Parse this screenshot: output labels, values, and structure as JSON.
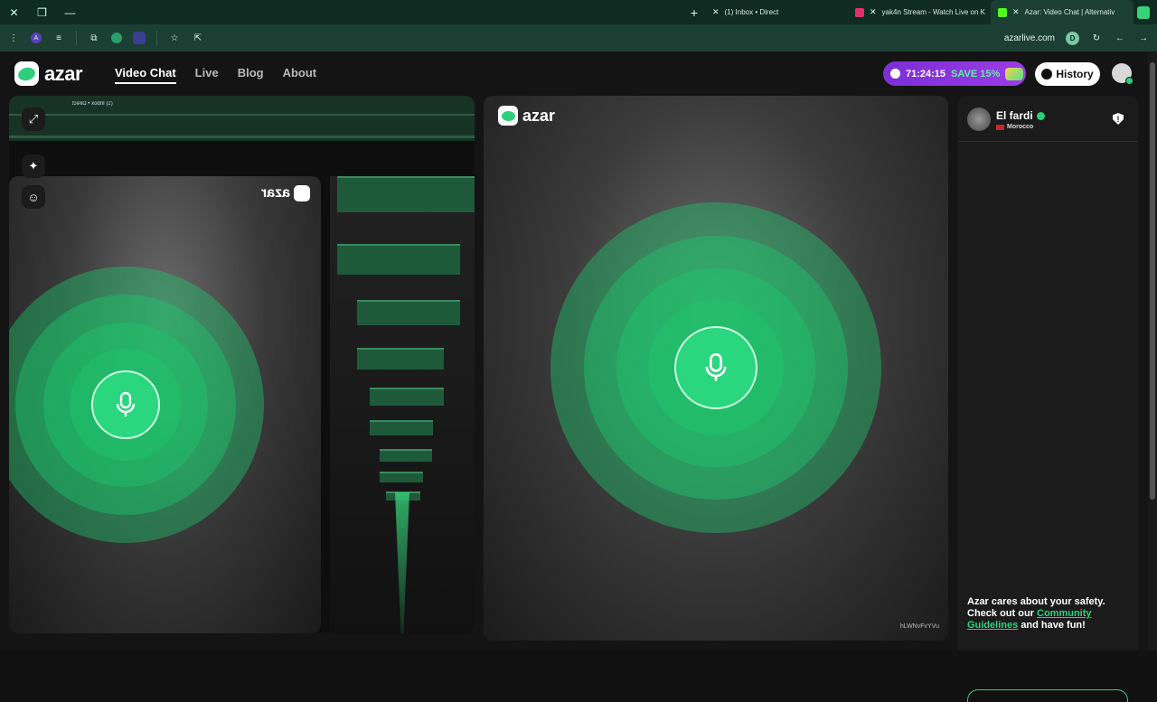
{
  "browser": {
    "tabs": [
      {
        "label": "(1) Inbox • Direct",
        "color": "#e1306c"
      },
      {
        "label": "yak4n Stream - Watch Live on K",
        "color": "#53fc18"
      },
      {
        "label": "Azar: Video Chat | Alternativ",
        "color": "#ffffff",
        "active": true
      }
    ],
    "url": "azarlive.com",
    "profile_initial": "D"
  },
  "site": {
    "logo": "azar",
    "nav": [
      "Video Chat",
      "Live",
      "Blog",
      "About"
    ],
    "timer": "71:24:15",
    "promo": "SAVE 15%",
    "history_label": "History"
  },
  "self_mirror": {
    "tab_label": "(1) Inbox • Direct",
    "brand": "azar"
  },
  "partner": {
    "brand": "azar",
    "name": "El fardi",
    "country": "Morocco",
    "watermark": "hLWNvFvYVu"
  },
  "chat": {
    "safety_text": "Azar cares about your safety. Check out our",
    "link_text": "Community Guidelines",
    "safety_tail": "and have fun!"
  },
  "colors": {
    "accent": "#2ed27c",
    "promo": "#8b35df"
  }
}
